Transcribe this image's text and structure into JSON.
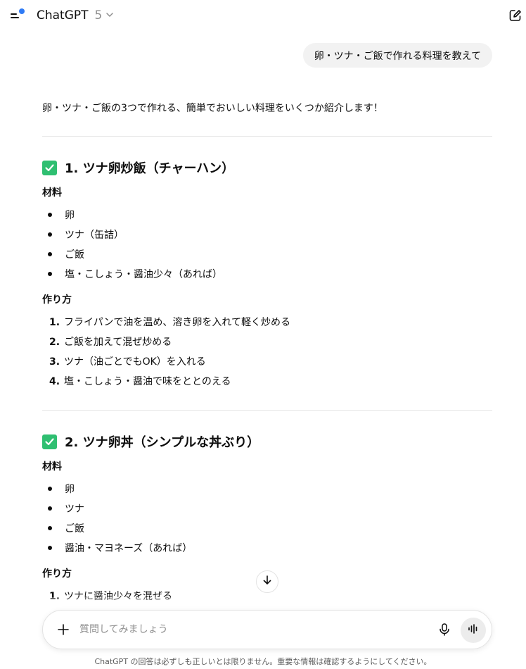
{
  "header": {
    "model_name": "ChatGPT",
    "model_version": "5"
  },
  "user_message": "卵・ツナ・ご飯で作れる料理を教えて",
  "assistant": {
    "intro": "卵・ツナ・ご飯の3つで作れる、簡単でおいしい料理をいくつか紹介します！",
    "sections": [
      {
        "title": "1. ツナ卵炒飯（チャーハン）",
        "ingredients_heading": "材料",
        "ingredients": [
          "卵",
          "ツナ（缶詰）",
          "ご飯",
          "塩・こしょう・醤油少々（あれば）"
        ],
        "steps_heading": "作り方",
        "steps": [
          {
            "num": "1.",
            "text": "フライパンで油を温め、溶き卵を入れて軽く炒める"
          },
          {
            "num": "2.",
            "text": "ご飯を加えて混ぜ炒める"
          },
          {
            "num": "3.",
            "text": "ツナ（油ごとでもOK）を入れる"
          },
          {
            "num": "4.",
            "text": "塩・こしょう・醤油で味をととのえる"
          }
        ]
      },
      {
        "title": "2. ツナ卵丼（シンプルな丼ぶり）",
        "ingredients_heading": "材料",
        "ingredients": [
          "卵",
          "ツナ",
          "ご飯",
          "醤油・マヨネーズ（あれば）"
        ],
        "steps_heading": "作り方",
        "steps": [
          {
            "num": "1.",
            "text": "ツナに醤油少々を混ぜる"
          }
        ]
      }
    ]
  },
  "composer": {
    "placeholder": "質問してみましょう"
  },
  "disclaimer": "ChatGPT の回答は必ずしも正しいとは限りません。重要な情報は確認するようにしてください。",
  "colors": {
    "accent_dot": "#2f7bf5",
    "check_green": "#2fbf71",
    "bubble_bg": "#f2f2f2"
  },
  "icons": [
    "sidebar-menu-icon",
    "chevron-down-icon",
    "new-chat-icon",
    "check-icon",
    "arrow-down-icon",
    "plus-icon",
    "microphone-icon",
    "voice-mode-icon"
  ]
}
